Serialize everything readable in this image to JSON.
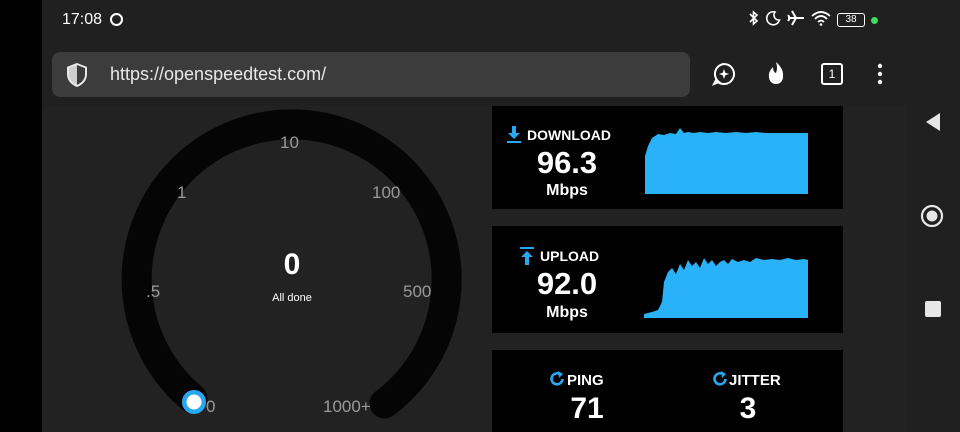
{
  "status": {
    "time": "17:08",
    "battery": "38",
    "icons": [
      "bluetooth-icon",
      "moon-icon",
      "airplane-icon",
      "wifi-icon",
      "battery-icon"
    ]
  },
  "browser": {
    "url": "https://openspeedtest.com/",
    "tab_count": "1"
  },
  "gauge": {
    "ticks": {
      "t0": "0",
      "t05": ".5",
      "t1": "1",
      "t10": "10",
      "t100": "100",
      "t500": "500",
      "t1000": "1000+"
    },
    "value": "0",
    "status": "All done"
  },
  "download": {
    "label": "DOWNLOAD",
    "value": "96.3",
    "unit": "Mbps"
  },
  "upload": {
    "label": "UPLOAD",
    "value": "92.0",
    "unit": "Mbps"
  },
  "ping": {
    "label": "PING",
    "value": "71"
  },
  "jitter": {
    "label": "JITTER",
    "value": "3"
  },
  "colors": {
    "accent": "#29a8f2",
    "panel": "#000000",
    "page": "#222222"
  }
}
